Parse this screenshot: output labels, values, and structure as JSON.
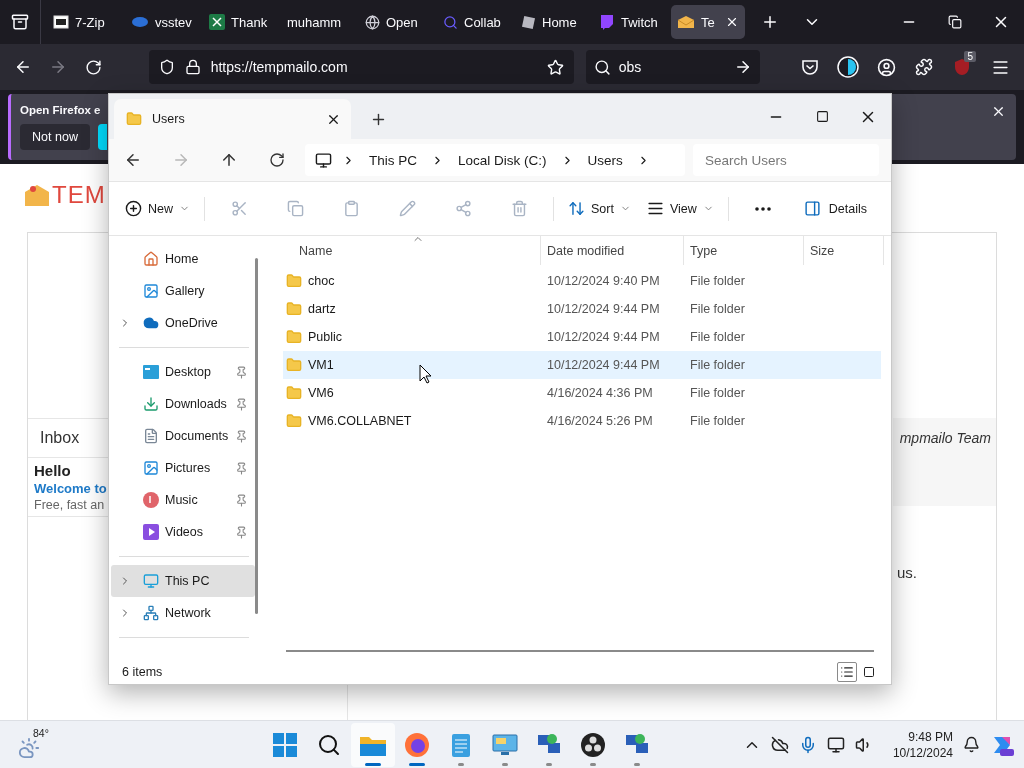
{
  "browser": {
    "tabs": [
      {
        "label": "7-Zip",
        "kind": "archive",
        "selected": false
      },
      {
        "label": "vsstev",
        "kind": "orb",
        "selected": false
      },
      {
        "label": "Thank",
        "kind": "sheet",
        "selected": false
      },
      {
        "label": "muhamm",
        "kind": "none",
        "selected": false
      },
      {
        "label": "Open",
        "kind": "globe",
        "selected": false
      },
      {
        "label": "Collab",
        "kind": "search",
        "selected": false
      },
      {
        "label": "Home",
        "kind": "cube",
        "selected": false
      },
      {
        "label": "Twitch",
        "kind": "twitch",
        "selected": false
      },
      {
        "label": "Te",
        "kind": "mail",
        "selected": true
      }
    ],
    "url": "https://tempmailo.com",
    "search": "obs",
    "badge": "5",
    "notice": {
      "text": "Open Firefox e",
      "button": "Not now"
    },
    "page": {
      "logo": "TEM",
      "inbox": "Inbox",
      "subject": "Hello",
      "title": "Welcome to",
      "preview": "Free, fast an",
      "signature": "mpmailo Team",
      "body_end": "us."
    }
  },
  "explorer": {
    "tab": "Users",
    "breadcrumb": [
      "This PC",
      "Local Disk (C:)",
      "Users"
    ],
    "search_placeholder": "Search Users",
    "toolbar": [
      {
        "kind": "new",
        "label": "New",
        "disabled": false
      },
      {
        "kind": "cut",
        "disabled": true
      },
      {
        "kind": "copy",
        "disabled": true
      },
      {
        "kind": "paste",
        "disabled": true
      },
      {
        "kind": "rename",
        "disabled": true
      },
      {
        "kind": "share",
        "disabled": true
      },
      {
        "kind": "delete",
        "disabled": true
      },
      {
        "kind": "sort",
        "label": "Sort",
        "disabled": false
      },
      {
        "kind": "view",
        "label": "View",
        "disabled": false
      },
      {
        "kind": "more"
      }
    ],
    "details": "Details",
    "nav": [
      {
        "items": [
          {
            "label": "Home",
            "kind": "home",
            "expandable": false,
            "pinned": false,
            "selected": false
          },
          {
            "label": "Gallery",
            "kind": "gallery",
            "expandable": false,
            "pinned": false,
            "selected": false
          },
          {
            "label": "OneDrive",
            "kind": "cloud",
            "expandable": true,
            "pinned": false,
            "selected": false
          }
        ]
      },
      {
        "items": [
          {
            "label": "Desktop",
            "kind": "desktop",
            "expandable": false,
            "pinned": true,
            "selected": false
          },
          {
            "label": "Downloads",
            "kind": "downloads",
            "expandable": false,
            "pinned": true,
            "selected": false
          },
          {
            "label": "Documents",
            "kind": "documents",
            "expandable": false,
            "pinned": true,
            "selected": false
          },
          {
            "label": "Pictures",
            "kind": "pictures",
            "expandable": false,
            "pinned": true,
            "selected": false
          },
          {
            "label": "Music",
            "kind": "music",
            "expandable": false,
            "pinned": true,
            "selected": false
          },
          {
            "label": "Videos",
            "kind": "videos",
            "expandable": false,
            "pinned": true,
            "selected": false
          }
        ]
      },
      {
        "items": [
          {
            "label": "This PC",
            "kind": "pc",
            "expandable": true,
            "pinned": false,
            "selected": true
          },
          {
            "label": "Network",
            "kind": "network",
            "expandable": true,
            "pinned": false,
            "selected": false
          }
        ]
      }
    ],
    "columns": [
      "Name",
      "Date modified",
      "Type",
      "Size"
    ],
    "rows": [
      {
        "name": "choc",
        "date": "10/12/2024 9:40 PM",
        "type": "File folder",
        "selected": false
      },
      {
        "name": "dartz",
        "date": "10/12/2024 9:44 PM",
        "type": "File folder",
        "selected": false
      },
      {
        "name": "Public",
        "date": "10/12/2024 9:44 PM",
        "type": "File folder",
        "selected": false
      },
      {
        "name": "VM1",
        "date": "10/12/2024 9:44 PM",
        "type": "File folder",
        "selected": true
      },
      {
        "name": "VM6",
        "date": "4/16/2024 4:36 PM",
        "type": "File folder",
        "selected": false
      },
      {
        "name": "VM6.COLLABNET",
        "date": "4/16/2024 5:26 PM",
        "type": "File folder",
        "selected": false
      }
    ],
    "status": "6 items",
    "views": [
      {
        "kind": "details",
        "selected": true
      },
      {
        "kind": "tiles",
        "selected": false
      }
    ]
  },
  "taskbar": {
    "weather": "84°",
    "apps": [
      {
        "kind": "start",
        "running": false,
        "active": false,
        "focused": false
      },
      {
        "kind": "search",
        "running": false,
        "active": false,
        "focused": false
      },
      {
        "kind": "explorer",
        "running": true,
        "active": true,
        "focused": true
      },
      {
        "kind": "firefox",
        "running": true,
        "active": true,
        "focused": false
      },
      {
        "kind": "notepad",
        "running": true,
        "active": false,
        "focused": false
      },
      {
        "kind": "remote",
        "running": true,
        "active": false,
        "focused": false
      },
      {
        "kind": "network",
        "running": true,
        "active": false,
        "focused": false
      },
      {
        "kind": "obs",
        "running": true,
        "active": false,
        "focused": false
      },
      {
        "kind": "network",
        "running": true,
        "active": false,
        "focused": false
      }
    ],
    "time": "9:48 PM",
    "date": "10/12/2024"
  }
}
